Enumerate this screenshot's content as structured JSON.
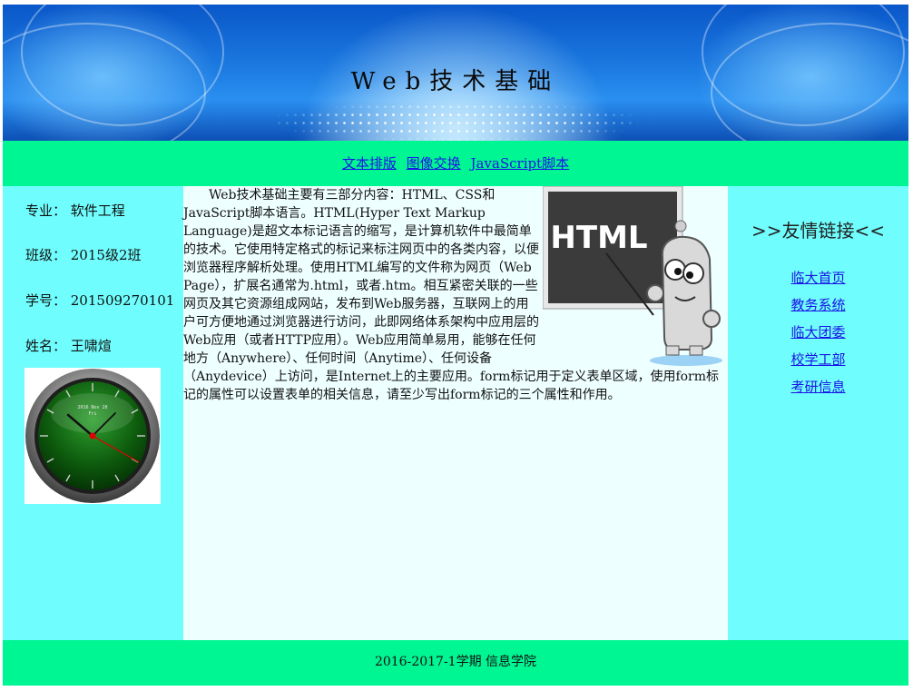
{
  "header": {
    "title": "Web技术基础"
  },
  "nav": {
    "links": [
      "文本排版",
      "图像交换",
      "JavaScript脚本"
    ]
  },
  "sidebar": {
    "major": "专业：  软件工程",
    "class": "班级：  2015级2班",
    "student_id": "学号：  201509270101",
    "name": "姓名：  王啸煊",
    "clock_label_top": "2016 Nov 28",
    "clock_label_day": "Fri"
  },
  "content": {
    "illustration_label": "HTML",
    "body": "Web技术基础主要有三部分内容：HTML、CSS和JavaScript脚本语言。HTML(Hyper Text Markup Language)是超文本标记语言的缩写，是计算机软件中最简单的技术。它使用特定格式的标记来标注网页中的各类内容，以便浏览器程序解析处理。使用HTML编写的文件称为网页（Web Page），扩展名通常为.html，或者.htm。相互紧密关联的一些网页及其它资源组成网站，发布到Web服务器，互联网上的用户可方便地通过浏览器进行访问，此即网络体系架构中应用层的Web应用（或者HTTP应用）。Web应用简单易用，能够在任何地方（Anywhere）、任何时间（Anytime）、任何设备（Anydevice）上访问，是Internet上的主要应用。form标记用于定义表单区域，使用form标记的属性可以设置表单的相关信息，请至少写出form标记的三个属性和作用。"
  },
  "friend_links": {
    "heading": ">>友情链接<<",
    "items": [
      "临大首页",
      "教务系统",
      "临大团委",
      "校学工部",
      "考研信息"
    ]
  },
  "footer": {
    "text": "2016-2017-1学期  信息学院"
  },
  "colors": {
    "nav_bg": "#00f593",
    "side_bg": "#70fdfd",
    "main_bg": "#eeffff",
    "link": "#1a14e6"
  }
}
